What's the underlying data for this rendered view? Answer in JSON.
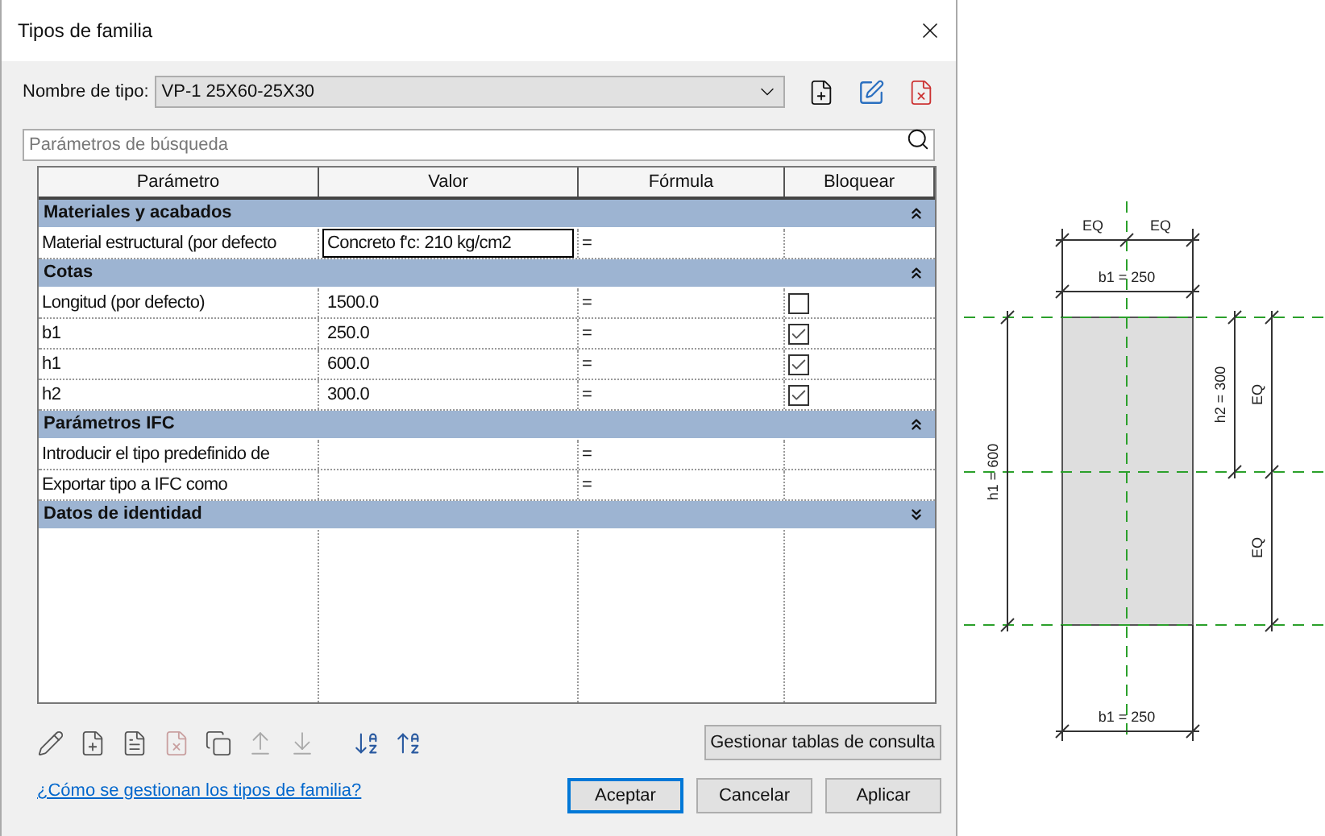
{
  "window": {
    "title": "Tipos de familia"
  },
  "type_name": {
    "label": "Nombre de tipo:",
    "value": "VP-1 25X60-25X30"
  },
  "search": {
    "placeholder": "Parámetros de búsqueda"
  },
  "table": {
    "columns": [
      "Parámetro",
      "Valor",
      "Fórmula",
      "Bloquear"
    ],
    "groups": [
      {
        "name": "Materiales y acabados",
        "expanded": true,
        "rows": [
          {
            "parameter": "Material estructural (por defecto",
            "value": "Concreto f'c: 210 kg/cm2",
            "formula": "=",
            "editing": true
          }
        ]
      },
      {
        "name": "Cotas",
        "expanded": true,
        "rows": [
          {
            "parameter": "Longitud (por defecto)",
            "value": "1500.0",
            "formula": "=",
            "editing": false,
            "locked": false
          },
          {
            "parameter": "b1",
            "value": "250.0",
            "formula": "=",
            "editing": false,
            "locked": true
          },
          {
            "parameter": "h1",
            "value": "600.0",
            "formula": "=",
            "editing": false,
            "locked": true
          },
          {
            "parameter": "h2",
            "value": "300.0",
            "formula": "=",
            "editing": false,
            "locked": true
          }
        ]
      },
      {
        "name": "Parámetros IFC",
        "expanded": true,
        "rows": [
          {
            "parameter": "Introducir el tipo predefinido de",
            "formula": "="
          },
          {
            "parameter": "Exportar tipo a IFC como",
            "formula": "="
          }
        ]
      },
      {
        "name": "Datos de identidad",
        "expanded": false
      }
    ]
  },
  "lookup_button": "Gestionar tablas de consulta",
  "help_link": "¿Cómo se gestionan los tipos de familia?",
  "buttons": [
    {
      "label": "Aceptar",
      "default": true
    },
    {
      "label": "Cancelar",
      "default": false
    },
    {
      "label": "Aplicar",
      "default": false
    }
  ],
  "drawing": {
    "labels": [
      "EQ",
      "EQ",
      "b1 = 250",
      "h2 = 300",
      "EQ",
      "h1 = 600",
      "EQ",
      "b1 = 250"
    ]
  }
}
